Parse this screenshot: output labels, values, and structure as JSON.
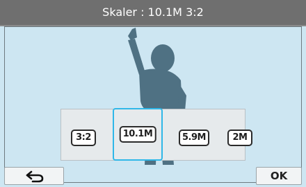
{
  "header": {
    "title": "Skaler : 10.1M 3:2"
  },
  "size_options": [
    {
      "label": "3:2",
      "selected": false
    },
    {
      "label": "10.1M",
      "selected": true
    },
    {
      "label": "5.9M",
      "selected": false
    },
    {
      "label": "2M",
      "selected": false
    }
  ],
  "buttons": {
    "back_icon": "back-arrow-icon",
    "ok_label": "OK"
  },
  "colors": {
    "header": "#6f6f6f",
    "background": "#cde6f2",
    "selection": "#2fb7e8",
    "silhouette": "#4f7183"
  }
}
